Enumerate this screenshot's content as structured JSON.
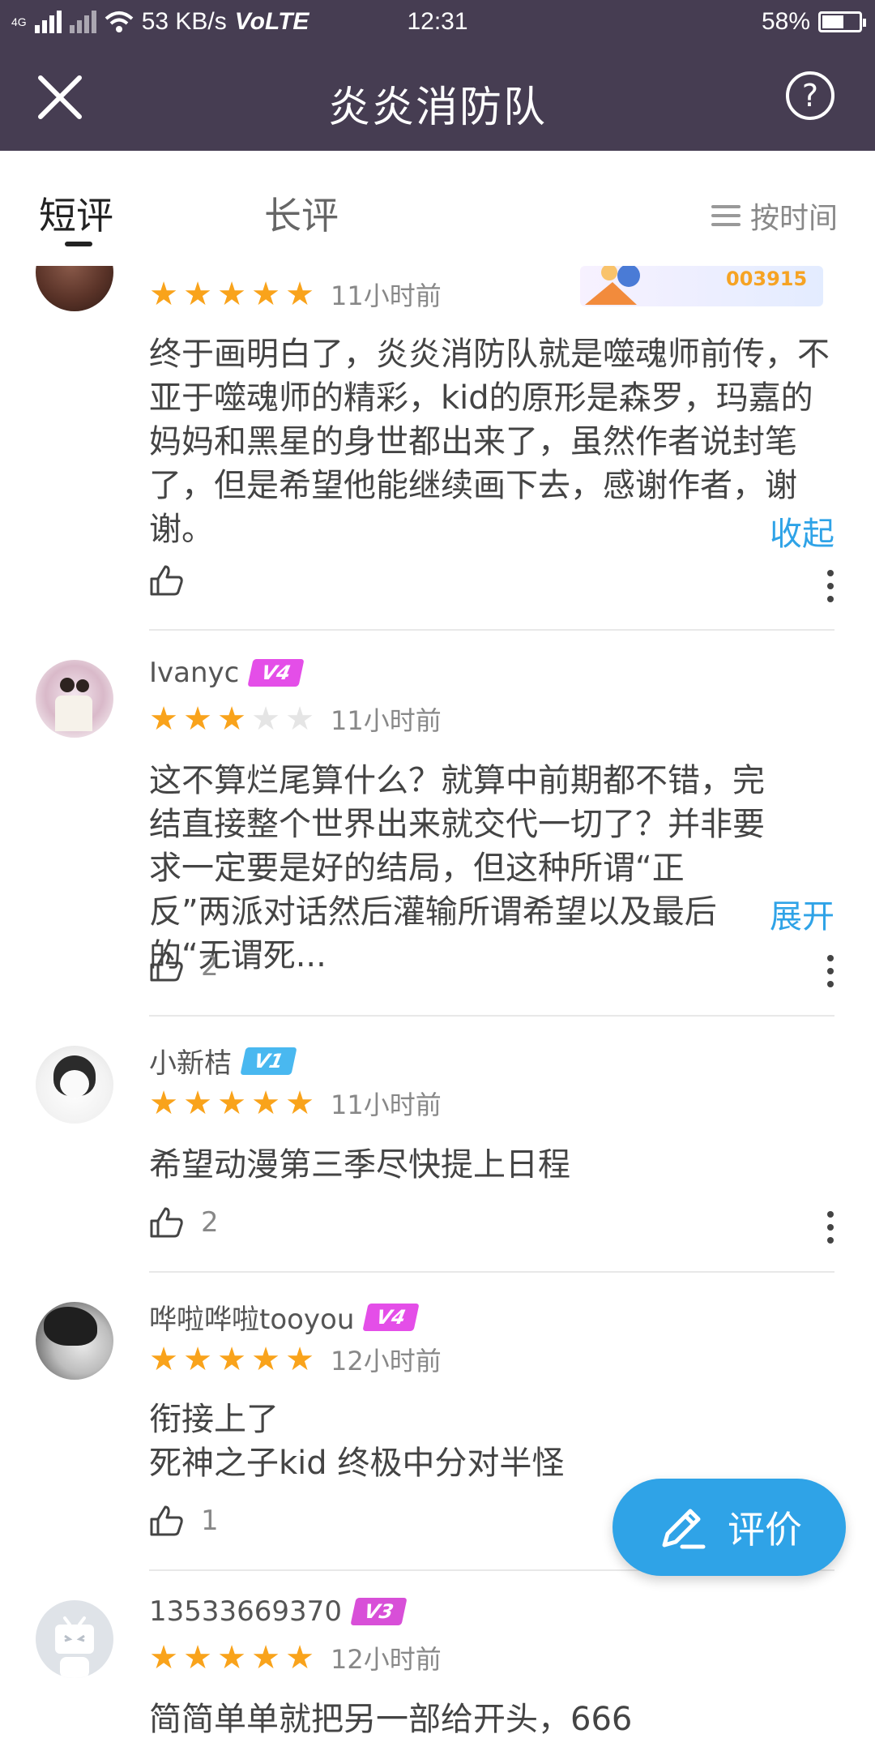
{
  "status_bar": {
    "network_label": "4G",
    "speed": "53 KB/s",
    "volte": "VoLTE",
    "time": "12:31",
    "battery": "58%",
    "battery_level": 0.58
  },
  "header": {
    "title": "炎炎消防队",
    "help_glyph": "?"
  },
  "tabs": {
    "short_label": "短评",
    "long_label": "长评",
    "sort_label": "按时间"
  },
  "reviews": [
    {
      "name": "",
      "level": "",
      "stars": 5,
      "time": "11小时前",
      "text": "终于画明白了，炎炎消防队就是噬魂师前传，不亚于噬魂师的精彩，kid的原形是森罗，玛嘉的妈妈和黑星的身世都出来了，虽然作者说封笔了，但是希望他能继续画下去，感谢作者，谢谢。",
      "toggle": "收起",
      "likes": "",
      "banner_text": "003915"
    },
    {
      "name": "Ivanyc",
      "level": "V4",
      "stars": 3,
      "time": "11小时前",
      "text": "这不算烂尾算什么？就算中前期都不错，完结直接整个世界出来就交代一切了？并非要求一定要是好的结局，但这种所谓“正反”两派对话然后灌输所谓希望以及最后的“无谓死...",
      "toggle": "展开",
      "likes": "2"
    },
    {
      "name": "小新桔",
      "level": "V1",
      "stars": 5,
      "time": "11小时前",
      "text": "希望动漫第三季尽快提上日程",
      "likes": "2"
    },
    {
      "name": "哗啦哗啦tooyou",
      "level": "V4",
      "stars": 5,
      "time": "12小时前",
      "text": "衔接上了\n死神之子kid 终极中分对半怪",
      "likes": "1"
    },
    {
      "name": "13533669370",
      "level": "V3",
      "stars": 5,
      "time": "12小时前",
      "text": "简简单单就把另一部给开头，666"
    }
  ],
  "fab": {
    "label": "评价"
  },
  "colors": {
    "header_bg": "#463d52",
    "accent_blue": "#2fa3e7",
    "star_orange": "#f9a31b",
    "star_empty": "#e5e5e5",
    "level_purple": "#e44ee8",
    "level_blue": "#49b8f0"
  },
  "icons": [
    "close-icon",
    "help-icon",
    "sort-lines-icon",
    "thumbs-up-icon",
    "more-vertical-icon",
    "edit-pen-icon",
    "star-icon"
  ]
}
